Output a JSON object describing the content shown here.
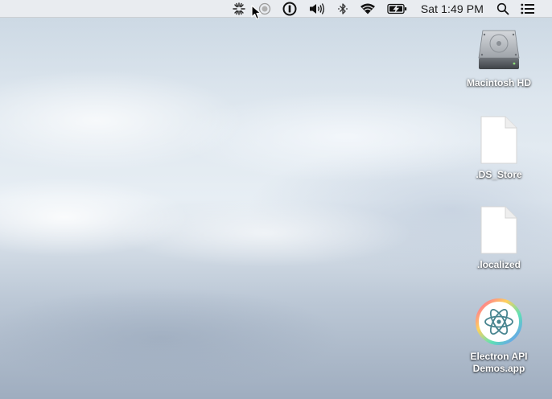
{
  "menubar": {
    "clock": "Sat 1:49 PM",
    "status_icons": [
      "activity-spinner-icon",
      "record-icon",
      "password-manager-icon",
      "volume-icon",
      "bluetooth-icon",
      "wifi-icon",
      "battery-charging-icon",
      "spotlight-search-icon",
      "notification-center-icon"
    ]
  },
  "desktop": {
    "items": [
      {
        "label": "Macintosh HD",
        "icon": "hard-drive-icon"
      },
      {
        "label": ".DS_Store",
        "icon": "document-icon"
      },
      {
        "label": ".localized",
        "icon": "document-icon"
      },
      {
        "label": "Electron API Demos.app",
        "icon": "electron-app-icon"
      }
    ]
  }
}
